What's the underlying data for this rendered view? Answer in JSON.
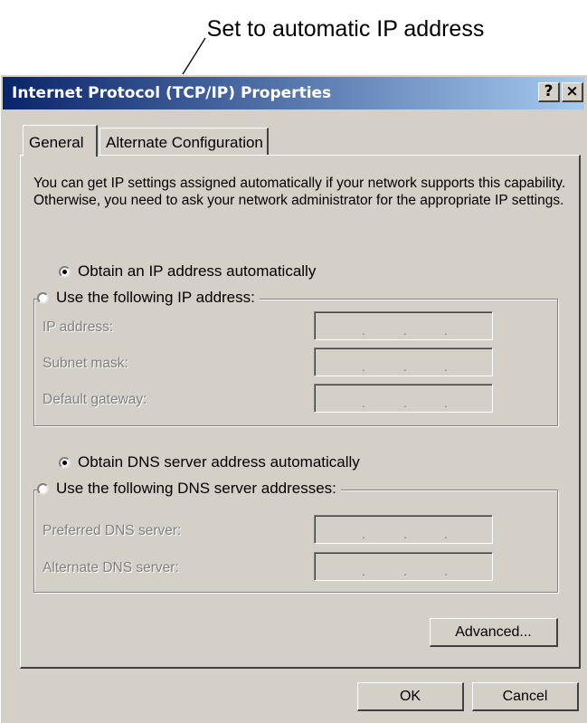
{
  "annotation": "Set to automatic IP address",
  "window": {
    "title": "Internet Protocol (TCP/IP) Properties",
    "help": "?",
    "close": "×"
  },
  "tabs": [
    "General",
    "Alternate Configuration"
  ],
  "intro": "You can get IP settings assigned automatically if your network supports this capability. Otherwise, you need to ask your network administrator for the appropriate IP settings.",
  "ip": {
    "auto_label": "Obtain an IP address automatically",
    "manual_label": "Use the following IP address:",
    "fields": [
      "IP address:",
      "Subnet mask:",
      "Default gateway:"
    ]
  },
  "dns": {
    "auto_label": "Obtain DNS server address automatically",
    "manual_label": "Use the following DNS server addresses:",
    "fields": [
      "Preferred DNS server:",
      "Alternate DNS server:"
    ]
  },
  "buttons": {
    "advanced": "Advanced...",
    "ok": "OK",
    "cancel": "Cancel"
  }
}
